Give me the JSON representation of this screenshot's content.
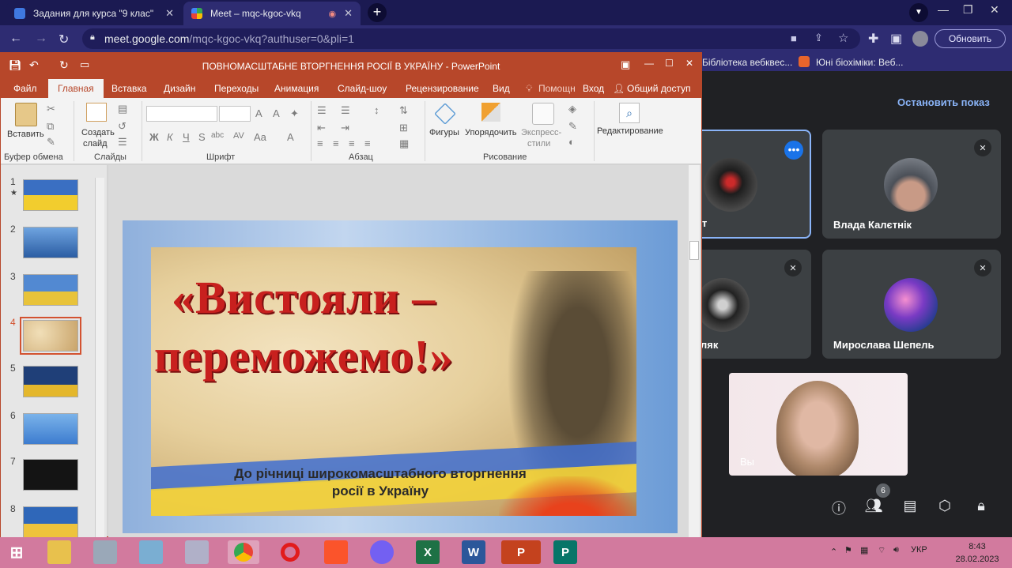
{
  "browser": {
    "tabs": [
      {
        "label": "Задания для курса \"9 клас\"",
        "active": false
      },
      {
        "label": "Meet – mqc-kgoc-vkq",
        "active": true
      }
    ],
    "url_host": "meet.google.com",
    "url_path": "/mqc-kgoc-vkq?authuser=0&pli=1",
    "update_label": "Обновить",
    "bookmarks": [
      "Бібліотека вебквес...",
      "Юні біохіміки: Веб..."
    ]
  },
  "meet": {
    "stop_show_label": "Остановить показ",
    "tiles": [
      {
        "name": "...т",
        "short": "т"
      },
      {
        "name": "Влада Калєтнік"
      },
      {
        "name": "...ляк",
        "short": "ляк"
      },
      {
        "name": "Мирослава Шепель"
      },
      {
        "name": "Вы"
      }
    ],
    "people_count": "6"
  },
  "powerpoint": {
    "title": "ПОВНОМАСШТАБНЕ ВТОРГНЕННЯ РОСІЇ В УКРАЇНУ - PowerPoint",
    "menu": [
      "Файл",
      "Главная",
      "Вставка",
      "Дизайн",
      "Переходы",
      "Анимация",
      "Слайд-шоу",
      "Рецензирование",
      "Вид",
      "Помощн",
      "Вход",
      "Общий доступ"
    ],
    "ribbon": {
      "paste": "Вставить",
      "new_slide_1": "Создать",
      "new_slide_2": "слайд",
      "shapes": "Фигуры",
      "arrange": "Упорядочить",
      "express_1": "Экспресс-",
      "express_2": "стили",
      "editing": "Редактирование",
      "groups": [
        "Буфер обмена",
        "Слайды",
        "Шрифт",
        "Абзац",
        "Рисование"
      ],
      "font_buttons": [
        "Ж",
        "К",
        "Ч",
        "S",
        "abc",
        "AV",
        "Aa",
        "A"
      ]
    },
    "slide_numbers": [
      "1",
      "2",
      "3",
      "4",
      "5",
      "6",
      "7",
      "8"
    ],
    "selected_slide": 4,
    "slide": {
      "title_line1": "«Вистояли –",
      "title_line2": "переможемо!»",
      "subtitle_line1": "До річниці широкомасштабного вторгнення",
      "subtitle_line2": "росії в Україну"
    }
  },
  "taskbar": {
    "lang": "УКР",
    "time": "8:43",
    "date": "28.02.2023"
  }
}
